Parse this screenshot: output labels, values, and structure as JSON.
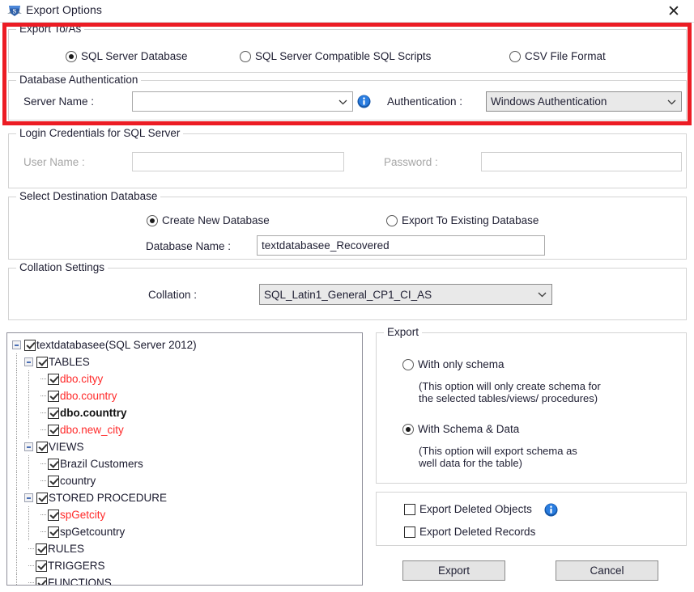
{
  "window": {
    "title": "Export Options",
    "icon": "app-shield-icon",
    "close_label": "✕"
  },
  "export_to_as": {
    "legend": "Export To/As",
    "options": [
      {
        "label": "SQL Server Database",
        "checked": true
      },
      {
        "label": "SQL Server Compatible SQL Scripts",
        "checked": false
      },
      {
        "label": "CSV File Format",
        "checked": false
      }
    ]
  },
  "database_authentication": {
    "legend": "Database Authentication",
    "server_name_label": "Server Name :",
    "server_name_value": "",
    "info_icon": "info-icon",
    "authentication_label": "Authentication :",
    "authentication_value": "Windows Authentication"
  },
  "login_credentials": {
    "legend": "Login Credentials for SQL Server",
    "user_name_label": "User Name :",
    "user_name_value": "",
    "password_label": "Password :",
    "password_value": ""
  },
  "destination": {
    "legend": "Select Destination Database",
    "options": [
      {
        "label": "Create New Database",
        "checked": true
      },
      {
        "label": "Export To Existing Database",
        "checked": false
      }
    ],
    "database_name_label": "Database Name :",
    "database_name_value": "textdatabasee_Recovered"
  },
  "collation": {
    "legend": "Collation Settings",
    "label": "Collation :",
    "value": "SQL_Latin1_General_CP1_CI_AS"
  },
  "tree": {
    "nodes": [
      {
        "indent": 0,
        "expander": true,
        "checked": true,
        "label": "textdatabasee(SQL Server 2012)",
        "style": "normal"
      },
      {
        "indent": 1,
        "expander": true,
        "checked": true,
        "label": "TABLES",
        "style": "normal"
      },
      {
        "indent": 2,
        "expander": false,
        "checked": true,
        "label": "dbo.cityy",
        "style": "red"
      },
      {
        "indent": 2,
        "expander": false,
        "checked": true,
        "label": "dbo.country",
        "style": "red"
      },
      {
        "indent": 2,
        "expander": false,
        "checked": true,
        "label": "dbo.counttry",
        "style": "bold"
      },
      {
        "indent": 2,
        "expander": false,
        "checked": true,
        "label": "dbo.new_city",
        "style": "red"
      },
      {
        "indent": 1,
        "expander": true,
        "checked": true,
        "label": "VIEWS",
        "style": "normal"
      },
      {
        "indent": 2,
        "expander": false,
        "checked": true,
        "label": "Brazil Customers",
        "style": "normal"
      },
      {
        "indent": 2,
        "expander": false,
        "checked": true,
        "label": "country",
        "style": "normal"
      },
      {
        "indent": 1,
        "expander": true,
        "checked": true,
        "label": "STORED PROCEDURE",
        "style": "normal"
      },
      {
        "indent": 2,
        "expander": false,
        "checked": true,
        "label": "spGetcity",
        "style": "red"
      },
      {
        "indent": 2,
        "expander": false,
        "checked": true,
        "label": "spGetcountry",
        "style": "normal"
      },
      {
        "indent": 1,
        "expander": false,
        "checked": true,
        "label": "RULES",
        "style": "normal"
      },
      {
        "indent": 1,
        "expander": false,
        "checked": true,
        "label": "TRIGGERS",
        "style": "normal"
      },
      {
        "indent": 1,
        "expander": false,
        "checked": true,
        "label": "FUNCTIONS",
        "style": "normal"
      }
    ]
  },
  "export_panel": {
    "legend": "Export",
    "schema_only": {
      "label": "With only schema",
      "checked": false,
      "description": "(This option will only create schema for\nthe  selected tables/views/ procedures)"
    },
    "schema_data": {
      "label": "With Schema & Data",
      "checked": true,
      "description": "(This option will export schema as\nwell data for the table)"
    }
  },
  "deleted_panel": {
    "export_deleted_objects": {
      "label": "Export Deleted Objects",
      "checked": false
    },
    "export_deleted_records": {
      "label": "Export Deleted Records",
      "checked": false
    },
    "info_icon": "info-icon"
  },
  "buttons": {
    "export": "Export",
    "cancel": "Cancel"
  },
  "colors": {
    "annotation": "#ec1c24",
    "red_text": "#ff2a2a",
    "info_blue": "#1f6fd0"
  }
}
